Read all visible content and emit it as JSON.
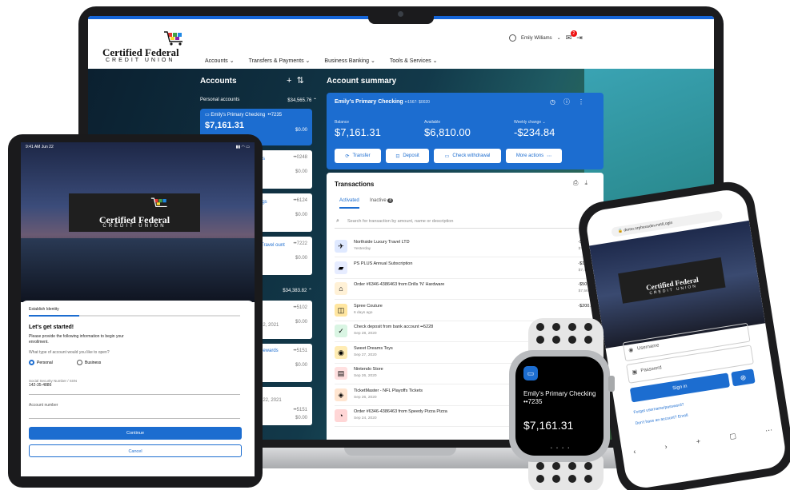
{
  "laptop": {
    "brand": {
      "name": "Certified Federal",
      "sub": "CREDIT UNION"
    },
    "nav": [
      "Accounts",
      "Transfers & Payments",
      "Business Banking",
      "Tools & Services"
    ],
    "user": {
      "name": "Emily Williams",
      "notif_count": "2"
    },
    "accounts": {
      "title": "Accounts",
      "personal_label": "Personal accounts",
      "personal_total": "$34,565.76",
      "selected": {
        "name": "Emily's Primary Checking",
        "mask": "••7235",
        "balance": "$7,161.31",
        "sub": "$0.00"
      },
      "items": [
        {
          "label": "ings",
          "num": "••0248",
          "val": "$0.00"
        },
        {
          "label": "ngs",
          "num": "••6124",
          "val": "$0.00"
        },
        {
          "label": "Travel ount",
          "num": "••7222",
          "val": "$0.00"
        }
      ],
      "group_total": "$34,383.82",
      "more_items": [
        {
          "label": "Aug 2, 2021",
          "num": "••5102",
          "val": "$0.00"
        },
        {
          "label": "Rewards",
          "num": "••5151",
          "val": "$0.00"
        },
        {
          "label": "Aug 22, 2021",
          "num": "••5151",
          "val": "$0.00"
        }
      ]
    },
    "summary": {
      "title": "Account summary",
      "account_name": "Emily's Primary Checking",
      "account_mask": "••1567: $0020",
      "balance_label": "Balance",
      "balance": "$7,161.31",
      "available_label": "Available",
      "available": "$6,810.00",
      "weekly_label": "Weekly change",
      "weekly": "-$234.84",
      "buttons": [
        "Transfer",
        "Deposit",
        "Check withdrawal",
        "More actions"
      ]
    },
    "transactions": {
      "title": "Transactions",
      "tabs": [
        "Activated",
        "Inactive"
      ],
      "inactive_count": "8",
      "search_placeholder": "Search for transaction by amount, name or description",
      "rows": [
        {
          "name": "Northside Luxury Travel LTD",
          "date": "Yesterday",
          "amt": "-$205.13",
          "bal": "$7,366.44",
          "icon": "plane-icon",
          "color": "#dfe9ff"
        },
        {
          "name": "PS PLUS Annual Subscription",
          "date": "",
          "amt": "-$100.00",
          "bal": "$7,466.44",
          "icon": "game-icon",
          "color": "#e6ecff"
        },
        {
          "name": "Order #6346-4386463 from Drills 'N' Hardware",
          "date": "",
          "amt": "-$509.99",
          "bal": "$7,566.44",
          "icon": "home-icon",
          "color": "#fff1d6"
        },
        {
          "name": "Spree Couture",
          "date": "6 days ago",
          "amt": "-$200.00",
          "bal": "",
          "icon": "bag-icon",
          "color": "#ffe6a0"
        },
        {
          "name": "Check deposit from bank account ••5228",
          "date": "Sep 28, 2020",
          "amt": "",
          "bal": "",
          "icon": "check-icon",
          "color": "#d9f5e3"
        },
        {
          "name": "Sweet Dreams Toys",
          "date": "Sep 27, 2020",
          "amt": "",
          "bal": "",
          "icon": "toy-icon",
          "color": "#ffecb3"
        },
        {
          "name": "Nintendo Store",
          "date": "Sep 26, 2020",
          "amt": "",
          "bal": "",
          "icon": "store-icon",
          "color": "#ffe0e0"
        },
        {
          "name": "TicketMaster - NFL Playoffs Tickets",
          "date": "Sep 26, 2020",
          "amt": "",
          "bal": "",
          "icon": "football-icon",
          "color": "#ffe5d0"
        },
        {
          "name": "Order #6346-4386463 from Speedy Pizza Pizza",
          "date": "Sep 24, 2020",
          "amt": "",
          "bal": "",
          "icon": "pizza-icon",
          "color": "#ffd6d6"
        }
      ]
    }
  },
  "tablet": {
    "status_time": "9:41 AM Jun 22",
    "brand": {
      "name": "Certified Federal",
      "sub": "CREDIT UNION"
    },
    "step_label": "Establish Identity",
    "heading": "Let's get started!",
    "intro": "Please provide the following information to begin your enrollment.",
    "question": "What type of account would you like to open?",
    "options": [
      "Personal",
      "Business"
    ],
    "ssn_label": "Social Security Number / SSN",
    "ssn_value": "142-35-4886",
    "account_label": "Account number",
    "continue": "Continue",
    "cancel": "Cancel"
  },
  "phone": {
    "url": "demo.orpheusdev.net/Login",
    "brand": {
      "name": "Certified Federal",
      "sub": "CREDIT UNION"
    },
    "username_ph": "Username",
    "password_ph": "Password",
    "signin": "Sign in",
    "forgot": "Forgot username/password?",
    "enroll": "Don't have an account? Enroll"
  },
  "watch": {
    "account": "Emily's Primary Checking ••7235",
    "balance": "$7,161.31"
  },
  "colors": {
    "accent": "#1c6dd0"
  }
}
